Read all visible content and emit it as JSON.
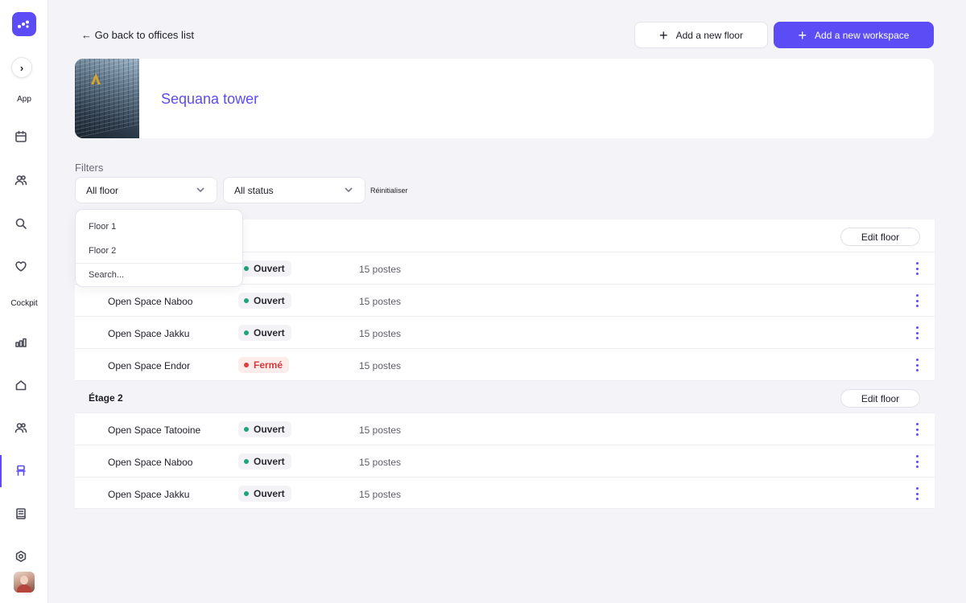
{
  "sidebar": {
    "logo_icon": "app-logo-icon",
    "expand_icon": "chevron-right-icon",
    "sections": [
      {
        "label": "App"
      },
      {
        "label": "Cockpit"
      }
    ],
    "active_color": "#5b4cf5",
    "icons_app": [
      "calendar-icon",
      "users-icon",
      "search-icon",
      "heart-icon"
    ],
    "icons_cockpit": [
      "bar-chart-icon",
      "home-icon",
      "users-icon",
      "chair-icon",
      "book-icon",
      "settings-icon"
    ]
  },
  "header": {
    "back_label": "← Go back to offices list",
    "add_floor_label": "Add a new floor",
    "add_workspace_label": "Add a new workspace"
  },
  "office": {
    "name": "Sequana tower"
  },
  "filters": {
    "label": "Filters",
    "floor_select": "All floor",
    "status_select": "All status",
    "reset_label": "Réinitialiser",
    "dropdown": {
      "options": [
        "Floor 1",
        "Floor 2"
      ],
      "search_placeholder": "Search..."
    }
  },
  "table": {
    "edit_floor_label": "Edit floor",
    "floors": [
      {
        "title": "",
        "rows": [
          {
            "name": "",
            "status": "Ouvert",
            "capacity": "15 postes"
          },
          {
            "name": "Open Space Naboo",
            "status": "Ouvert",
            "capacity": "15 postes"
          },
          {
            "name": "Open Space Jakku",
            "status": "Ouvert",
            "capacity": "15 postes"
          },
          {
            "name": "Open Space Endor",
            "status": "Fermé",
            "capacity": "15 postes"
          }
        ]
      },
      {
        "title": "Étage 2",
        "rows": [
          {
            "name": "Open Space Tatooine",
            "status": "Ouvert",
            "capacity": "15 postes"
          },
          {
            "name": "Open Space Naboo",
            "status": "Ouvert",
            "capacity": "15 postes"
          },
          {
            "name": "Open Space Jakku",
            "status": "Ouvert",
            "capacity": "15 postes"
          }
        ]
      }
    ]
  },
  "colors": {
    "accent": "#5b4cf5",
    "open_dot": "#1fa37a",
    "closed": "#e23b3b"
  }
}
